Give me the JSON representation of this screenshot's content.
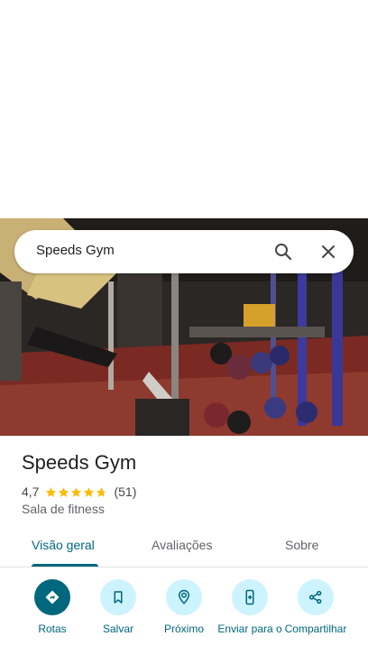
{
  "search": {
    "value": "Speeds Gym"
  },
  "place": {
    "name": "Speeds Gym",
    "rating": "4,7",
    "rating_value": 4.7,
    "review_count": "(51)",
    "category": "Sala de fitness"
  },
  "tabs": [
    {
      "label": "Visão geral",
      "active": true
    },
    {
      "label": "Avaliações",
      "active": false
    },
    {
      "label": "Sobre",
      "active": false
    }
  ],
  "actions": [
    {
      "label": "Rotas",
      "icon": "directions-icon"
    },
    {
      "label": "Salvar",
      "icon": "bookmark-icon"
    },
    {
      "label": "Próximo",
      "icon": "nearby-icon"
    },
    {
      "label": "Enviar para o",
      "icon": "send-to-phone-icon"
    },
    {
      "label": "Compartilhar",
      "icon": "share-icon"
    }
  ],
  "colors": {
    "accent": "#00677d",
    "action_bg": "#cdf3ff",
    "star": "#fbbc04"
  }
}
